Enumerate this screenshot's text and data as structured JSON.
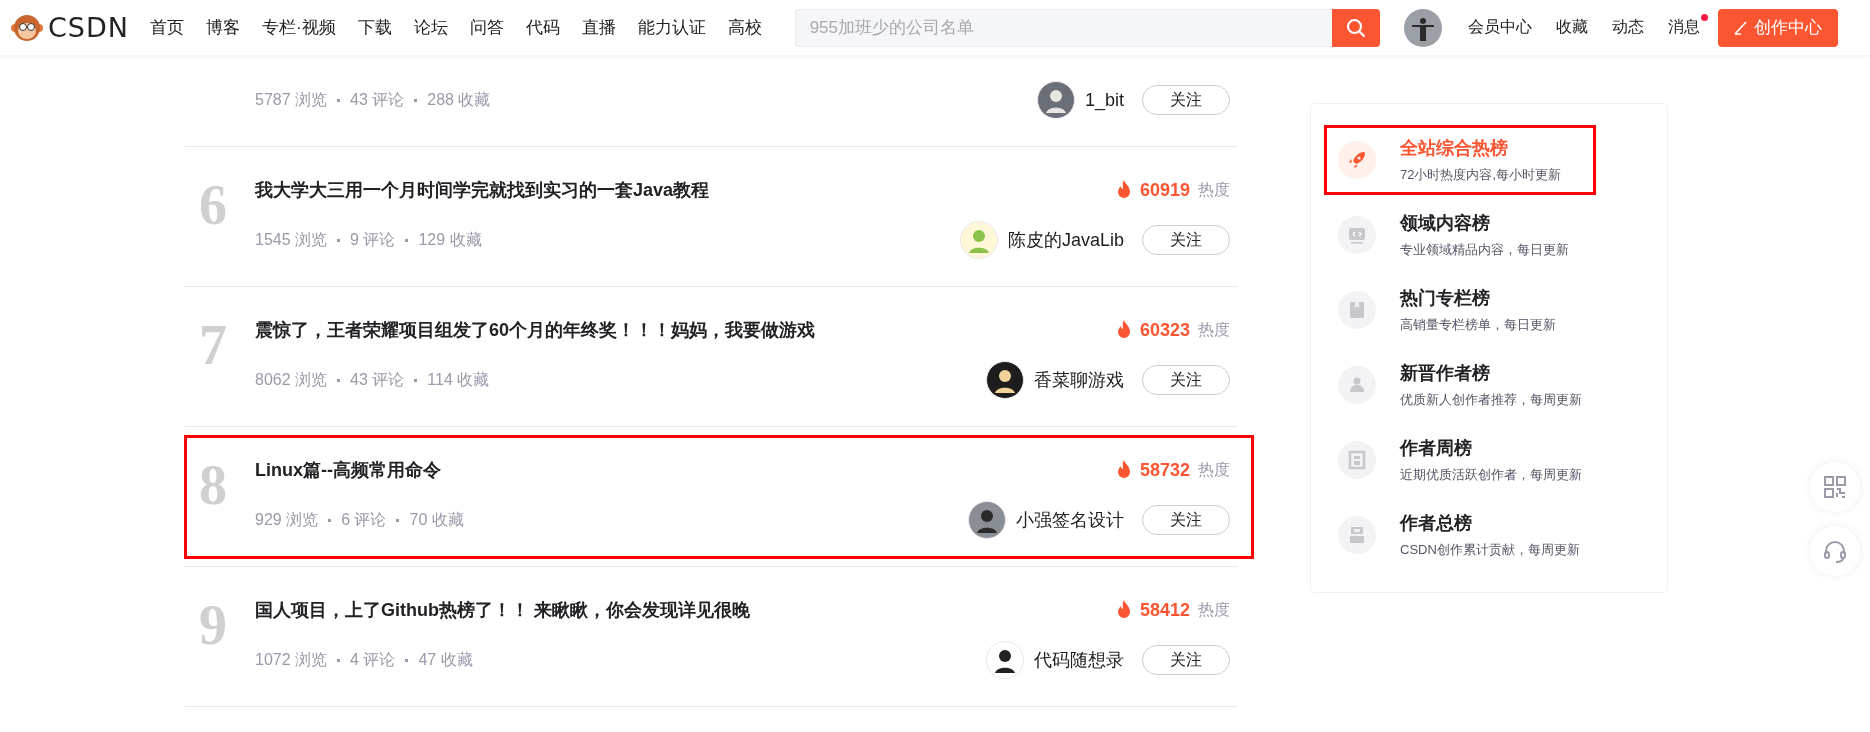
{
  "header": {
    "logo": "CSDN",
    "nav": [
      "首页",
      "博客",
      "专栏·视频",
      "下载",
      "论坛",
      "问答",
      "代码",
      "直播",
      "能力认证",
      "高校"
    ],
    "search": {
      "placeholder": "955加班少的公司名单"
    },
    "links": [
      {
        "label": "会员中心",
        "unread": false
      },
      {
        "label": "收藏",
        "unread": false
      },
      {
        "label": "动态",
        "unread": false
      },
      {
        "label": "消息",
        "unread": true
      }
    ],
    "create_button": "创作中心"
  },
  "articles": [
    {
      "meta": [
        "5787 浏览",
        "43 评论",
        "288 收藏"
      ],
      "author": "1_bit",
      "follow": "关注",
      "highlighted": false
    },
    {
      "rank": "6",
      "title": "我大学大三用一个月时间学完就找到实习的一套Java教程",
      "heat": "60919",
      "heat_label": "热度",
      "meta": [
        "1545 浏览",
        "9 评论",
        "129 收藏"
      ],
      "author": "陈皮的JavaLib",
      "follow": "关注",
      "highlighted": false
    },
    {
      "rank": "7",
      "title": "震惊了，王者荣耀项目组发了60个月的年终奖！！！妈妈，我要做游戏",
      "heat": "60323",
      "heat_label": "热度",
      "meta": [
        "8062 浏览",
        "43 评论",
        "114 收藏"
      ],
      "author": "香菜聊游戏",
      "follow": "关注",
      "highlighted": false
    },
    {
      "rank": "8",
      "title": "Linux篇--高频常用命令",
      "heat": "58732",
      "heat_label": "热度",
      "meta": [
        "929 浏览",
        "6 评论",
        "70 收藏"
      ],
      "author": "小强签名设计",
      "follow": "关注",
      "highlighted": true
    },
    {
      "rank": "9",
      "title": "国人项目，上了Github热榜了！！ 来瞅瞅，你会发现详见很晚",
      "heat": "58412",
      "heat_label": "热度",
      "meta": [
        "1072 浏览",
        "4 评论",
        "47 收藏"
      ],
      "author": "代码随想录",
      "follow": "关注",
      "highlighted": false
    }
  ],
  "rankings": [
    {
      "title": "全站综合热榜",
      "subtitle": "72小时热度内容,每小时更新",
      "selected": true,
      "highlighted": true
    },
    {
      "title": "领域内容榜",
      "subtitle": "专业领域精品内容，每日更新",
      "selected": false,
      "highlighted": false
    },
    {
      "title": "热门专栏榜",
      "subtitle": "高销量专栏榜单，每日更新",
      "selected": false,
      "highlighted": false
    },
    {
      "title": "新晋作者榜",
      "subtitle": "优质新人创作者推荐，每周更新",
      "selected": false,
      "highlighted": false
    },
    {
      "title": "作者周榜",
      "subtitle": "近期优质活跃创作者，每周更新",
      "selected": false,
      "highlighted": false
    },
    {
      "title": "作者总榜",
      "subtitle": "CSDN创作累计贡献，每周更新",
      "selected": false,
      "highlighted": false
    }
  ]
}
